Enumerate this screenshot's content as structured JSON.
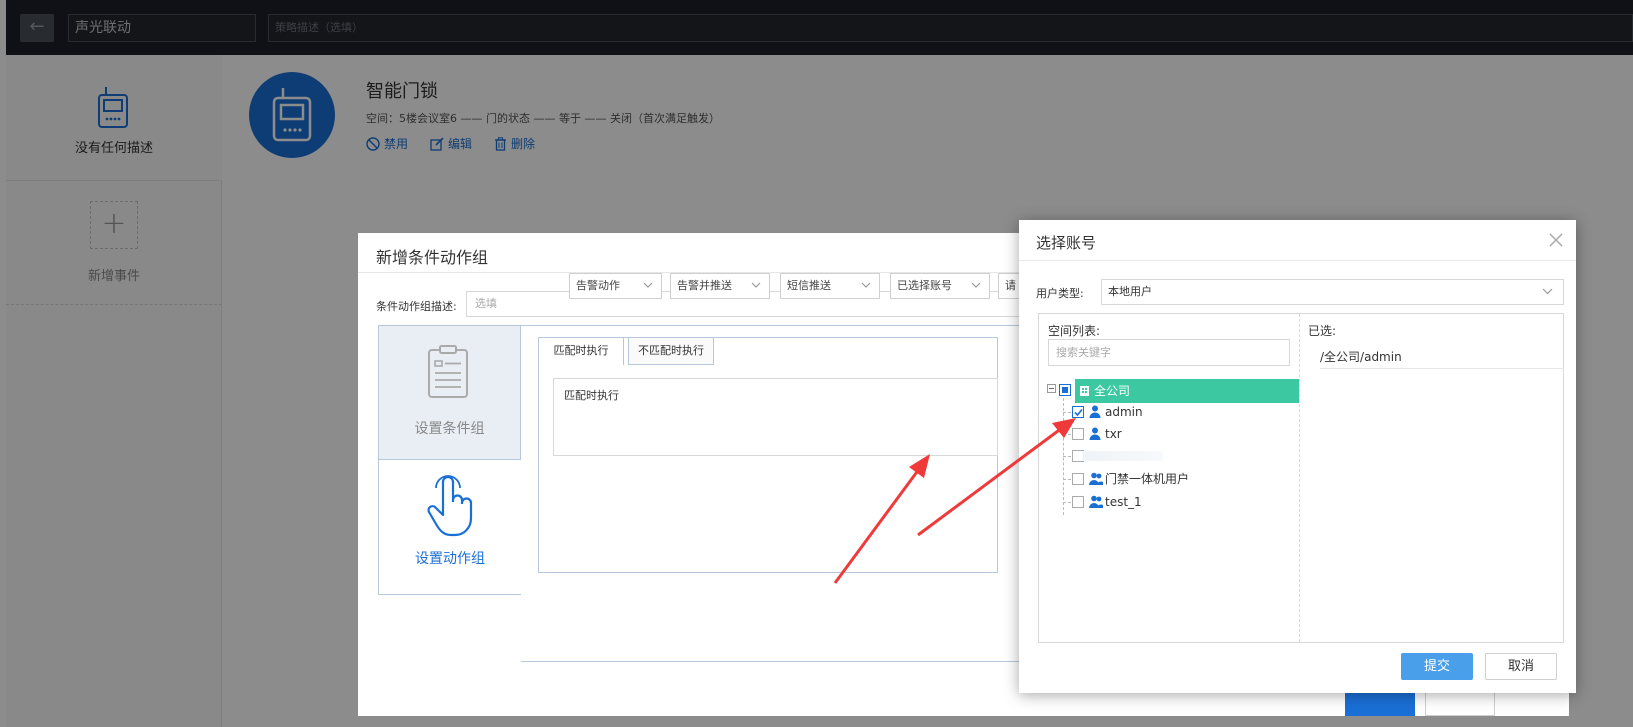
{
  "header": {
    "back_icon": "arrow-left-icon",
    "title_value": "声光联动",
    "desc_placeholder": "策略描述（选填）"
  },
  "sidebar": {
    "device_label": "没有任何描述",
    "add_label": "新增事件",
    "add_symbol": "+"
  },
  "rule": {
    "name": "智能门锁",
    "description": "空间：5楼会议室6 —— 门的状态 —— 等于 —— 关闭（首次满足触发）",
    "actions": [
      "禁用",
      "编辑",
      "删除"
    ]
  },
  "condition_dialog": {
    "title": "新增条件动作组",
    "desc_label": "条件动作组描述:",
    "desc_placeholder": "选填",
    "side_tabs": [
      "设置条件组",
      "设置动作组"
    ],
    "tabs": [
      "匹配时执行",
      "不匹配时执行"
    ],
    "exec_label": "匹配时执行",
    "selects": [
      "告警动作",
      "告警并推送",
      "短信推送",
      "已选择账号",
      "请"
    ]
  },
  "account_dialog": {
    "title": "选择账号",
    "close_icon": "close-icon",
    "user_type_label": "用户类型:",
    "user_type_value": "本地用户",
    "space_list_label": "空间列表:",
    "search_placeholder": "搜索关键字",
    "selected_label": "已选:",
    "selected_items": [
      "/全公司/admin"
    ],
    "tree": {
      "root": "全公司",
      "children": [
        {
          "label": "admin",
          "checked": true,
          "icon": "user-icon"
        },
        {
          "label": "txr",
          "checked": false,
          "icon": "user-icon"
        },
        {
          "label": "",
          "checked": false,
          "icon": "user-icon"
        },
        {
          "label": "门禁一体机用户",
          "checked": false,
          "icon": "user-group-icon"
        },
        {
          "label": "test_1",
          "checked": false,
          "icon": "user-group-icon"
        }
      ]
    },
    "submit_label": "提交",
    "cancel_label": "取消"
  },
  "colors": {
    "accent": "#1a6fd6",
    "tree_highlight": "#3cc8a0",
    "submit": "#4a9fea",
    "arrow": "#f03a3a"
  }
}
